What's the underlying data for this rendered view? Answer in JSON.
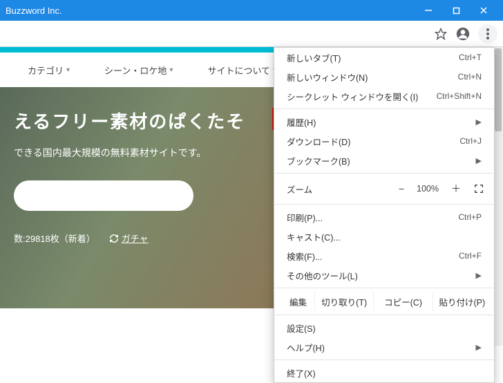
{
  "titlebar": {
    "title": "Buzzword Inc."
  },
  "nav": {
    "items": [
      "カテゴリ",
      "シーン・ロケ地",
      "サイトについて"
    ]
  },
  "hero": {
    "headline": "えるフリー素材のぱくたそ",
    "sub": "できる国内最大規模の無料素材サイトです。",
    "count_label": "数:29818枚（新着）",
    "gacha": "ガチャ"
  },
  "menu": {
    "new_tab": "新しいタブ(T)",
    "new_tab_sc": "Ctrl+T",
    "new_win": "新しいウィンドウ(N)",
    "new_win_sc": "Ctrl+N",
    "incog": "シークレット ウィンドウを開く(I)",
    "incog_sc": "Ctrl+Shift+N",
    "history": "履歴(H)",
    "downloads": "ダウンロード(D)",
    "downloads_sc": "Ctrl+J",
    "bookmarks": "ブックマーク(B)",
    "zoom_lbl": "ズーム",
    "zoom_minus": "−",
    "zoom_pct": "100%",
    "zoom_plus": "＋",
    "print": "印刷(P)...",
    "print_sc": "Ctrl+P",
    "cast": "キャスト(C)...",
    "find": "検索(F)...",
    "find_sc": "Ctrl+F",
    "moretools": "その他のツール(L)",
    "edit_lbl": "編集",
    "cut": "切り取り(T)",
    "copy": "コピー(C)",
    "paste": "貼り付け(P)",
    "settings": "設定(S)",
    "help": "ヘルプ(H)",
    "exit": "終了(X)"
  }
}
